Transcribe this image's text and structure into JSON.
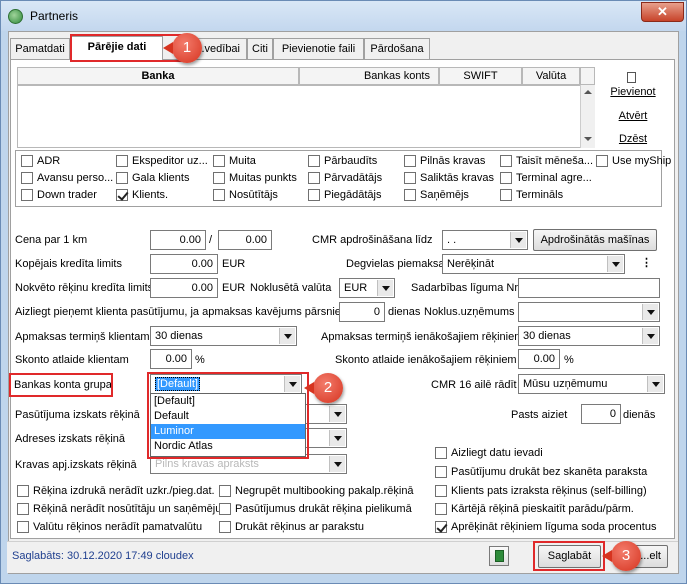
{
  "window": {
    "title": "Partneris",
    "close_glyph": "✕"
  },
  "tabs": [
    {
      "label": "Pamatdati"
    },
    {
      "label": "Pārējie dati"
    },
    {
      "label": "...vedībai"
    },
    {
      "label": "Citi"
    },
    {
      "label": "Pievienotie faili"
    },
    {
      "label": "Pārdošana"
    }
  ],
  "annotations": {
    "step1": "1",
    "step2": "2",
    "step3": "3"
  },
  "bank_grid": {
    "columns": [
      "Banka",
      "Bankas konts",
      "SWIFT",
      "Valūta"
    ]
  },
  "bank_buttons": {
    "add": "Pievienot",
    "open": "Atvērt",
    "delete": "Dzēst"
  },
  "flags": [
    {
      "label": "ADR",
      "checked": false
    },
    {
      "label": "Ekspeditor uz...",
      "checked": false
    },
    {
      "label": "Muita",
      "checked": false
    },
    {
      "label": "Pārbaudīts",
      "checked": false
    },
    {
      "label": "Pilnās kravas",
      "checked": false
    },
    {
      "label": "Taisīt mēneša...",
      "checked": false
    },
    {
      "label": "Use myShip",
      "checked": false
    },
    {
      "label": "Avansu perso...",
      "checked": false
    },
    {
      "label": "Gala klients",
      "checked": false
    },
    {
      "label": "Muitas punkts",
      "checked": false
    },
    {
      "label": "Pārvadātājs",
      "checked": false
    },
    {
      "label": "Saliktās kravas",
      "checked": false
    },
    {
      "label": "Terminal agre...",
      "checked": false
    },
    {
      "label": "Down trader",
      "checked": false
    },
    {
      "label": "Klients.",
      "checked": true
    },
    {
      "label": "Nosūtītājs",
      "checked": false
    },
    {
      "label": "Piegādātājs",
      "checked": false
    },
    {
      "label": "Saņēmējs",
      "checked": false
    },
    {
      "label": "Termināls",
      "checked": false
    }
  ],
  "form": {
    "price_per_km": {
      "label": "Cena par 1 km",
      "value1": "0.00",
      "sep": "/",
      "value2": "0.00"
    },
    "cmr_insurance": {
      "label": "CMR apdrošināšana līdz",
      "value": ". .",
      "button": "Apdrošinātās mašīnas"
    },
    "total_credit": {
      "label": "Kopējais kredīta limits",
      "value": "0.00",
      "currency": "EUR"
    },
    "fuel_payer": {
      "label": "Degvielas piemaksa",
      "value": "Nerēķināt",
      "more": "⋮"
    },
    "overdue_credit": {
      "label": "Nokvēto rēķinu kredīta limits",
      "value": "0.00",
      "currency": "EUR"
    },
    "default_currency": {
      "label": "Noklusētā valūta",
      "value": "EUR"
    },
    "contract_no": {
      "label": "Sadarbības līguma Nr.",
      "value": ""
    },
    "deny_orders": {
      "label": "Aizliegt pieņemt klienta pasūtījumu, ja apmaksas kavējums pārsniedz",
      "value": "0",
      "unit": "dienas"
    },
    "default_company": {
      "label": "Noklus.uzņēmums",
      "value": ""
    },
    "client_payment_term": {
      "label": "Apmaksas termiņš klientam",
      "value": "30 dienas"
    },
    "incoming_payment_term": {
      "label": "Apmaksas termiņš ienākošajiem rēķiniem",
      "value": "30 dienas"
    },
    "client_discount": {
      "label": "Skonto atlaide klientam",
      "value": "0.00",
      "unit": "%"
    },
    "incoming_discount": {
      "label": "Skonto atlaide ienākošajiem rēķiniem",
      "value": "0.00",
      "unit": "%"
    },
    "bank_account_group": {
      "label": "Bankas konta grupa",
      "value": "[Default]",
      "options": [
        "[Default]",
        "Default",
        "Luminor",
        "Nordic Atlas"
      ],
      "highlighted": "Luminor"
    },
    "cmr16": {
      "label": "CMR 16 ailē rādīt",
      "value": "Mūsu uzņēmumu"
    },
    "order_invoice_view": {
      "label": "Pasūtījuma izskats rēķinā"
    },
    "pasts_aiziet": {
      "label": "Pasts aiziet",
      "value": "0",
      "unit": "dienās"
    },
    "address_view": {
      "label": "Adreses izskats rēķinā"
    },
    "cargo_view": {
      "label": "Kravas apj.izskats rēķinā",
      "value": "Pilns kravas apraksts"
    }
  },
  "options_left": [
    {
      "label": "Rēķina izdrukā nerādīt uzkr./pieg.dat.",
      "checked": false
    },
    {
      "label": "Rēķinā nerādīt nosūtītāju un saņēmēju",
      "checked": false
    },
    {
      "label": "Valūtu rēķinos nerādīt pamatvalūtu",
      "checked": false
    }
  ],
  "options_mid": [
    {
      "label": "Negrupēt multibooking pakalp.rēķinā",
      "checked": false
    },
    {
      "label": "Pasūtījumus drukāt rēķina pielikumā",
      "checked": false
    },
    {
      "label": "Drukāt rēķinus ar parakstu",
      "checked": false
    }
  ],
  "options_right": [
    {
      "label": "Aizliegt datu ievadi",
      "checked": false
    },
    {
      "label": "Pasūtījumu drukāt bez skanēta paraksta",
      "checked": false
    },
    {
      "label": "Klients pats izraksta rēķinus (self-billing)",
      "checked": false
    },
    {
      "label": "Kārtējā rēķinā pieskaitīt parādu/pārm.",
      "checked": false
    },
    {
      "label": "Aprēķināt rēķiniem līguma soda procentus",
      "checked": true
    }
  ],
  "status": {
    "saved_text": "Saglabāts: 30.12.2020 17:49 cloudex",
    "save_button": "Saglabāt",
    "exit_button": "...elt"
  },
  "colors": {
    "highlight": "#e0292a",
    "badge": "#d63420",
    "selection": "#3399ff"
  }
}
